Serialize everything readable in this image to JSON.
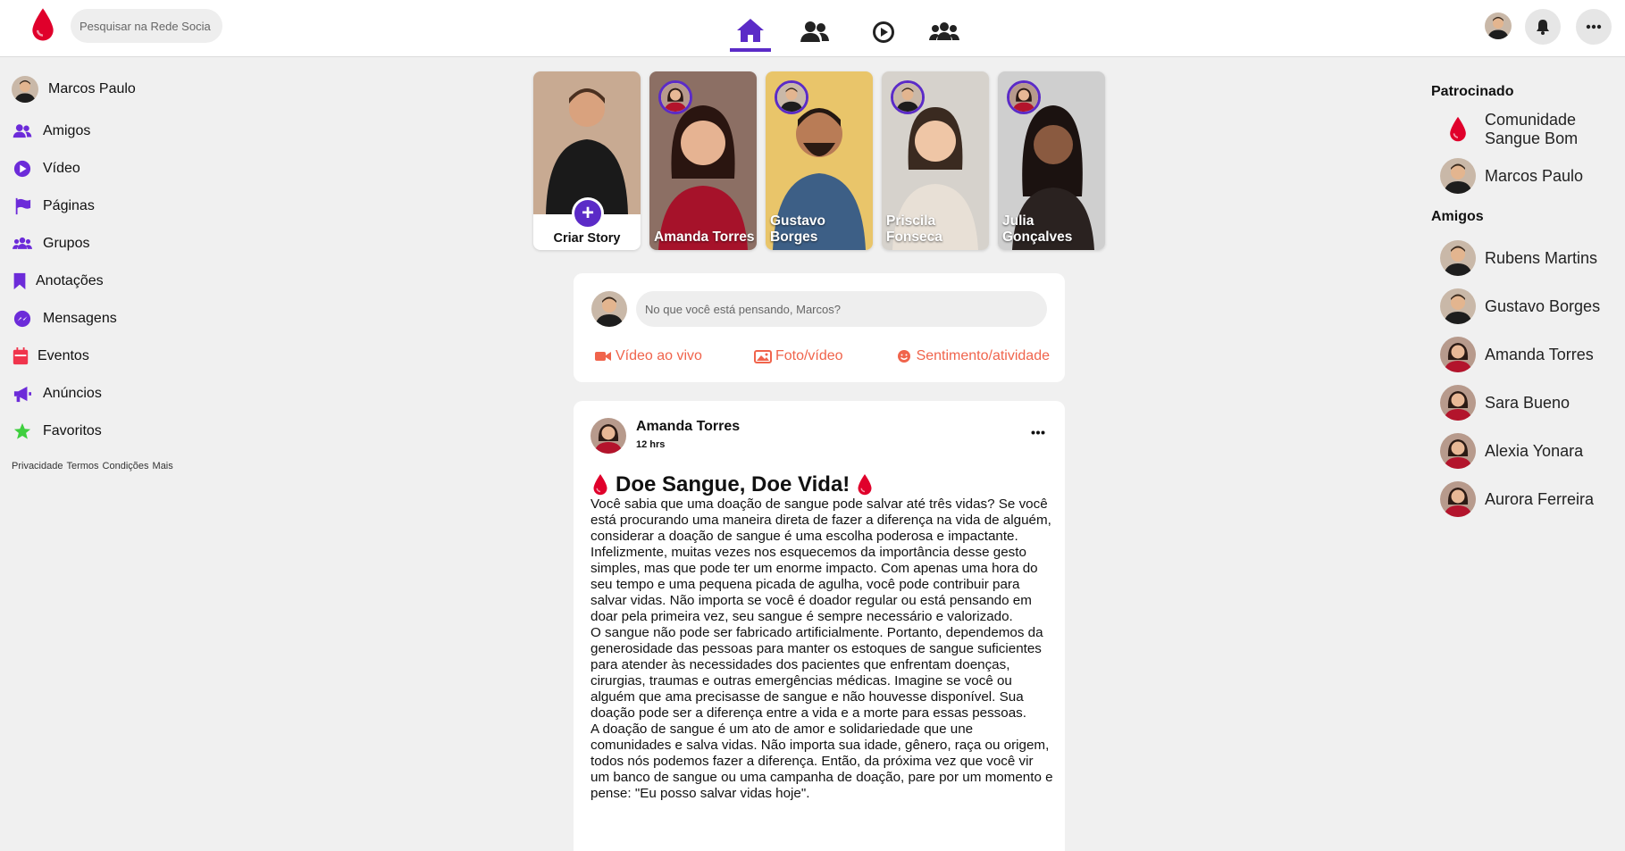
{
  "header": {
    "search_placeholder": "Pesquisar na Rede Socia",
    "brand_color": "#e0002b",
    "accent_color": "#5b2bc7",
    "nav": [
      {
        "icon": "home-icon",
        "active": true
      },
      {
        "icon": "friends-icon",
        "active": false
      },
      {
        "icon": "video-play-icon",
        "active": false
      },
      {
        "icon": "groups-icon",
        "active": false
      }
    ]
  },
  "sidebar": {
    "profile_name": "Marcos Paulo",
    "items": [
      {
        "label": "Amigos",
        "icon": "friends-icon"
      },
      {
        "label": "Vídeo",
        "icon": "video-play-icon"
      },
      {
        "label": "Páginas",
        "icon": "flag-icon"
      },
      {
        "label": "Grupos",
        "icon": "groups-icon"
      },
      {
        "label": "Anotações",
        "icon": "bookmark-icon"
      },
      {
        "label": "Mensagens",
        "icon": "messenger-icon"
      },
      {
        "label": "Eventos",
        "icon": "calendar-icon"
      },
      {
        "label": "Anúncios",
        "icon": "megaphone-icon"
      },
      {
        "label": "Favoritos",
        "icon": "star-icon"
      }
    ],
    "footer_links": [
      "Privacidade",
      "Termos",
      "Condições",
      "Mais"
    ]
  },
  "stories": {
    "create_label": "Criar Story",
    "items": [
      {
        "name": "Amanda Torres"
      },
      {
        "name": "Gustavo Borges"
      },
      {
        "name": "Priscila Fonseca"
      },
      {
        "name": "Julia Gonçalves"
      }
    ]
  },
  "composer": {
    "placeholder": "No que você está pensando, Marcos?",
    "actions": [
      {
        "label": "Vídeo ao vivo",
        "icon": "video-camera-icon"
      },
      {
        "label": "Foto/vídeo",
        "icon": "photo-icon"
      },
      {
        "label": "Sentimento/atividade",
        "icon": "smile-icon"
      }
    ]
  },
  "post": {
    "author": "Amanda Torres",
    "time": "12 hrs",
    "title": "Doe Sangue, Doe Vida!",
    "body": "Você sabia que uma doação de sangue pode salvar até três vidas? Se você está procurando uma maneira direta de fazer a diferença na vida de alguém, considerar a doação de sangue é uma escolha poderosa e impactante.\nInfelizmente, muitas vezes nos esquecemos da importância desse gesto simples, mas que pode ter um enorme impacto. Com apenas uma hora do seu tempo e uma pequena picada de agulha, você pode contribuir para salvar vidas. Não importa se você é doador regular ou está pensando em doar pela primeira vez, seu sangue é sempre necessário e valorizado.\nO sangue não pode ser fabricado artificialmente. Portanto, dependemos da generosidade das pessoas para manter os estoques de sangue suficientes para atender às necessidades dos pacientes que enfrentam doenças, cirurgias, traumas e outras emergências médicas. Imagine se você ou alguém que ama precisasse de sangue e não houvesse disponível. Sua doação pode ser a diferença entre a vida e a morte para essas pessoas.\nA doação de sangue é um ato de amor e solidariedade que une comunidades e salva vidas. Não importa sua idade, gênero, raça ou origem, todos nós podemos fazer a diferença. Então, da próxima vez que você vir um banco de sangue ou uma campanha de doação, pare por um momento e pense: \"Eu posso salvar vidas hoje\"."
  },
  "right": {
    "sponsored_heading": "Patrocinado",
    "sponsored": [
      {
        "name": "Comunidade Sangue Bom"
      },
      {
        "name": "Marcos Paulo"
      }
    ],
    "friends_heading": "Amigos",
    "friends": [
      {
        "name": "Rubens Martins"
      },
      {
        "name": "Gustavo Borges"
      },
      {
        "name": "Amanda Torres"
      },
      {
        "name": "Sara Bueno"
      },
      {
        "name": "Alexia Yonara"
      },
      {
        "name": "Aurora Ferreira"
      }
    ]
  }
}
